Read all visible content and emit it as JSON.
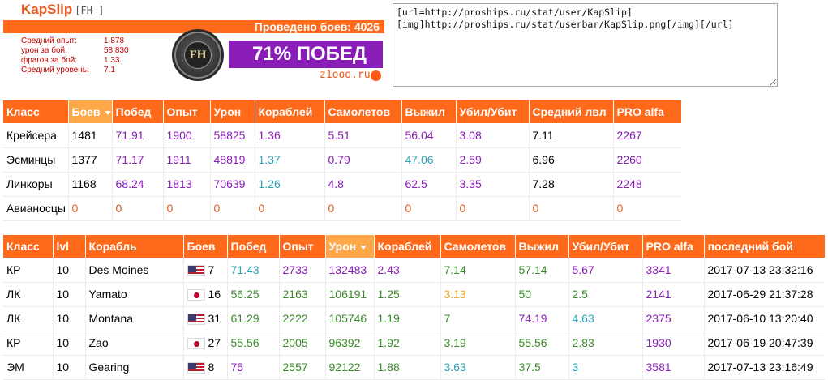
{
  "userbar": {
    "name": "KapSlip",
    "clan": "[FH-]",
    "battles_text": "Проведено боев: 4026",
    "stats": [
      {
        "label": "Средний опыт:",
        "value": "1 878"
      },
      {
        "label": "урон за бой:",
        "value": "58 830"
      },
      {
        "label": "фрагов за бой:",
        "value": "1.33"
      },
      {
        "label": "Средний уровень:",
        "value": "7.1"
      }
    ],
    "logo_text": "FH",
    "wins_text": "71% ПОБЕД",
    "site": "z1ooo.ru"
  },
  "bbcode": "[url=http://proships.ru/stat/user/KapSlip]\n[img]http://proships.ru/stat/userbar/KapSlip.png[/img][/url]",
  "class_table": {
    "headers": [
      "Класс",
      "Боев",
      "Побед",
      "Опыт",
      "Урон",
      "Кораблей",
      "Самолетов",
      "Выжил",
      "Убил/Убит",
      "Средний лвл",
      "PRO alfa"
    ],
    "rows": [
      [
        "Крейсера",
        "1481",
        "71.91",
        "1900",
        "58825",
        "1.36",
        "5.51",
        "56.04",
        "3.08",
        "7.11",
        "2267"
      ],
      [
        "Эсминцы",
        "1377",
        "71.17",
        "1911",
        "48819",
        "1.37",
        "0.79",
        "47.06",
        "2.59",
        "6.96",
        "2260"
      ],
      [
        "Линкоры",
        "1168",
        "68.24",
        "1813",
        "70639",
        "1.26",
        "4.8",
        "62.5",
        "3.35",
        "7.28",
        "2248"
      ],
      [
        "Авианосцы",
        "0",
        "0",
        "0",
        "0",
        "0",
        "0",
        "0",
        "0",
        "0",
        "0"
      ]
    ],
    "colors": [
      [
        "#000000",
        "#000000",
        "#8a1db7",
        "#8a1db7",
        "#8a1db7",
        "#8a1db7",
        "#8a1db7",
        "#8a1db7",
        "#8a1db7",
        "#000000",
        "#8a1db7"
      ],
      [
        "#000000",
        "#000000",
        "#8a1db7",
        "#8a1db7",
        "#8a1db7",
        "#2aa0b8",
        "#8a1db7",
        "#2aa0b8",
        "#8a1db7",
        "#000000",
        "#8a1db7"
      ],
      [
        "#000000",
        "#000000",
        "#8a1db7",
        "#8a1db7",
        "#8a1db7",
        "#2aa0b8",
        "#8a1db7",
        "#8a1db7",
        "#8a1db7",
        "#000000",
        "#8a1db7"
      ],
      [
        "#000000",
        "#e8571e",
        "#e8571e",
        "#e8571e",
        "#e8571e",
        "#e8571e",
        "#e8571e",
        "#e8571e",
        "#e8571e",
        "#e8571e",
        "#e8571e"
      ]
    ],
    "sorted_col": 1
  },
  "ship_table": {
    "headers": [
      "Класс",
      "lvl",
      "Корабль",
      "Боев",
      "Побед",
      "Опыт",
      "Урон",
      "Кораблей",
      "Самолетов",
      "Выжил",
      "Убил/Убит",
      "PRO alfa",
      "последний бой"
    ],
    "rows": [
      {
        "cls": "КР",
        "lvl": "10",
        "ship": "Des Moines",
        "flag": "us",
        "battles": "7",
        "wins": "71.43",
        "xp": "2733",
        "dmg": "132483",
        "ships": "2.43",
        "planes": "7.14",
        "surv": "57.14",
        "kd": "5.67",
        "pro": "3341",
        "last": "2017-07-13 23:32:16"
      },
      {
        "cls": "ЛК",
        "lvl": "10",
        "ship": "Yamato",
        "flag": "jp",
        "battles": "16",
        "wins": "56.25",
        "xp": "2163",
        "dmg": "106191",
        "ships": "1.25",
        "planes": "3.13",
        "surv": "50",
        "kd": "2.5",
        "pro": "2141",
        "last": "2017-06-29 21:37:28"
      },
      {
        "cls": "ЛК",
        "lvl": "10",
        "ship": "Montana",
        "flag": "us",
        "battles": "31",
        "wins": "61.29",
        "xp": "2222",
        "dmg": "105746",
        "ships": "1.19",
        "planes": "7",
        "surv": "74.19",
        "kd": "4.63",
        "pro": "2375",
        "last": "2017-06-10 13:20:40"
      },
      {
        "cls": "КР",
        "lvl": "10",
        "ship": "Zao",
        "flag": "jp",
        "battles": "27",
        "wins": "55.56",
        "xp": "2005",
        "dmg": "96392",
        "ships": "1.92",
        "planes": "3.19",
        "surv": "55.56",
        "kd": "2.83",
        "pro": "1930",
        "last": "2017-06-19 20:47:39"
      },
      {
        "cls": "ЭМ",
        "lvl": "10",
        "ship": "Gearing",
        "flag": "us",
        "battles": "8",
        "wins": "75",
        "xp": "2557",
        "dmg": "92122",
        "ships": "1.88",
        "planes": "3.63",
        "surv": "37.5",
        "kd": "3",
        "pro": "3581",
        "last": "2017-07-13 23:16:49"
      }
    ],
    "colors": [
      {
        "wins": "#2aa0b8",
        "xp": "#8a1db7",
        "dmg": "#8a1db7",
        "ships": "#8a1db7",
        "planes": "#3a8a2a",
        "surv": "#3a8a2a",
        "kd": "#8a1db7",
        "pro": "#8a1db7"
      },
      {
        "wins": "#3a8a2a",
        "xp": "#3a8a2a",
        "dmg": "#3a8a2a",
        "ships": "#3a8a2a",
        "planes": "#f0a020",
        "surv": "#3a8a2a",
        "kd": "#3a8a2a",
        "pro": "#8a1db7"
      },
      {
        "wins": "#3a8a2a",
        "xp": "#3a8a2a",
        "dmg": "#3a8a2a",
        "ships": "#3a8a2a",
        "planes": "#3a8a2a",
        "surv": "#8a1db7",
        "kd": "#2aa0b8",
        "pro": "#8a1db7"
      },
      {
        "wins": "#3a8a2a",
        "xp": "#3a8a2a",
        "dmg": "#3a8a2a",
        "ships": "#3a8a2a",
        "planes": "#3a8a2a",
        "surv": "#3a8a2a",
        "kd": "#3a8a2a",
        "pro": "#8a1db7"
      },
      {
        "wins": "#8a1db7",
        "xp": "#3a8a2a",
        "dmg": "#3a8a2a",
        "ships": "#3a8a2a",
        "planes": "#2aa0b8",
        "surv": "#3a8a2a",
        "kd": "#2aa0b8",
        "pro": "#8a1db7"
      }
    ],
    "sorted_col": 6
  }
}
